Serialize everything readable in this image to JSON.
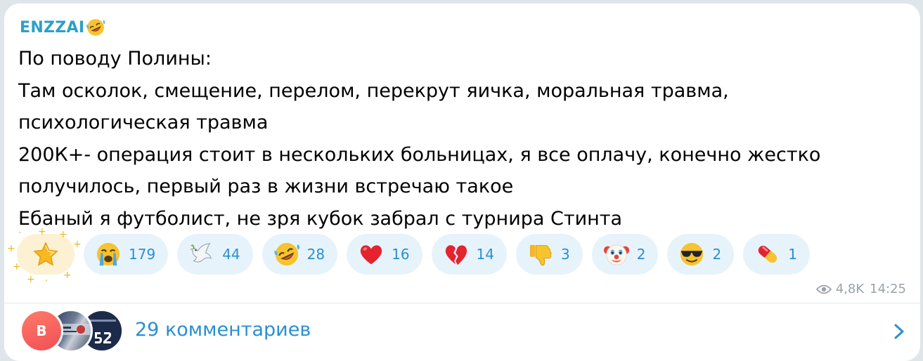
{
  "message": {
    "sender": "ENZZAI",
    "sender_emoji": "rolling-on-floor-laughing-emoji",
    "lines": [
      "По поводу Полины:",
      "Там осколок, смещение, перелом, перекрут яичка, моральная травма,",
      "психологическая травма",
      "200К+- операция стоит в нескольких больницах, я все оплачу, конечно жестко",
      "получилось, первый раз в жизни встречаю такое",
      "Ебаный я футболист, не зря кубок забрал с турнира Стинта"
    ]
  },
  "reactions": [
    {
      "emoji": "star-emoji",
      "count": "",
      "paid": true
    },
    {
      "emoji": "loudly-crying-face-emoji",
      "count": "179"
    },
    {
      "emoji": "dove-emoji",
      "count": "44"
    },
    {
      "emoji": "rolling-on-floor-laughing-emoji",
      "count": "28"
    },
    {
      "emoji": "red-heart-emoji",
      "count": "16"
    },
    {
      "emoji": "broken-heart-emoji",
      "count": "14"
    },
    {
      "emoji": "thumbs-down-emoji",
      "count": "3"
    },
    {
      "emoji": "clown-face-emoji",
      "count": "2"
    },
    {
      "emoji": "smiling-face-with-sunglasses-emoji",
      "count": "2"
    },
    {
      "emoji": "pill-emoji",
      "count": "1"
    }
  ],
  "meta": {
    "views": "4,8K",
    "time": "14:25"
  },
  "comments": {
    "label": "29 комментариев",
    "avatars": [
      {
        "initial": "B",
        "color": "#f25a5a"
      },
      {
        "initial": "",
        "color": "#2b3a56"
      },
      {
        "initial": "",
        "color": "#1d2b4a"
      }
    ]
  },
  "colors": {
    "accent": "#2a8fd0",
    "sender": "#2e9fc9",
    "reaction_bg": "#e7f3fb",
    "meta": "#9aa3aa"
  }
}
